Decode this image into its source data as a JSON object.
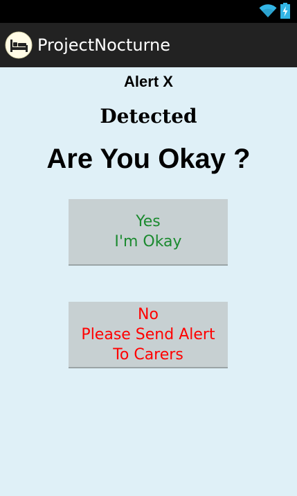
{
  "status_bar": {
    "icons": [
      "wifi-icon",
      "battery-charging-icon"
    ],
    "wifi_color": "#33b5e5",
    "battery_color": "#33b5e5"
  },
  "action_bar": {
    "app_icon": "bed-icon",
    "title": "ProjectNocturne"
  },
  "content": {
    "alert_label": "Alert X",
    "detected_label": "Detected",
    "question": "Are You Okay ?",
    "yes_button": {
      "line1": "Yes",
      "line2": "I'm Okay",
      "color": "#1b8a2f"
    },
    "no_button": {
      "line1": "No",
      "line2": "Please Send Alert",
      "line3": "To Carers",
      "color": "#ff0000"
    }
  },
  "colors": {
    "background": "#dff0f7",
    "action_bar": "#222222",
    "button_bg": "#c7d0d2"
  }
}
